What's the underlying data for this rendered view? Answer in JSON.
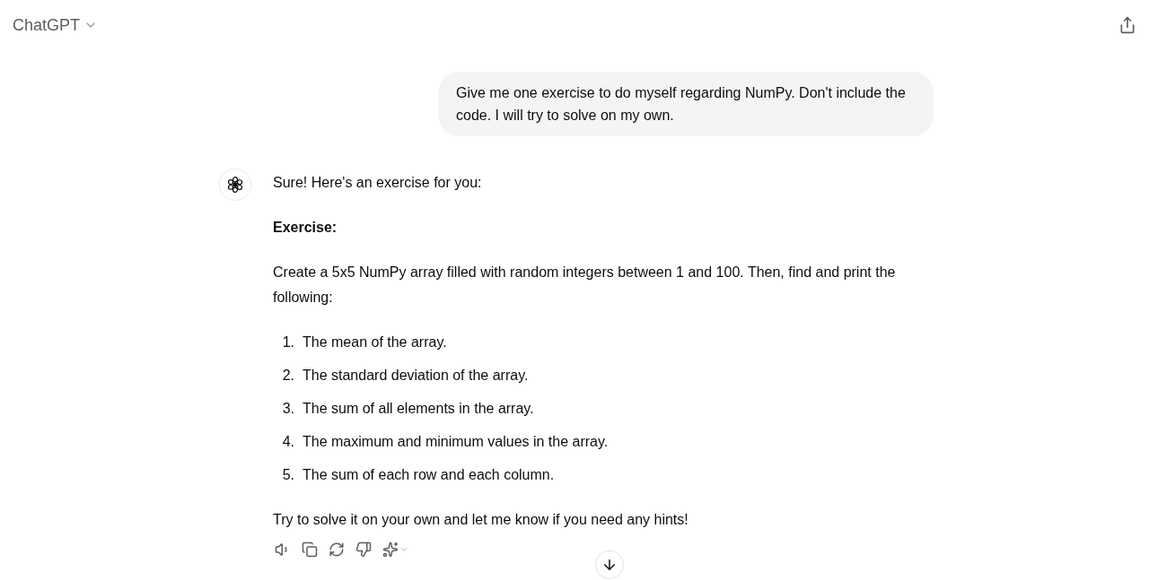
{
  "header": {
    "title": "ChatGPT"
  },
  "user_message": {
    "text": "Give me one exercise to do myself regarding NumPy. Don't include the code. I will try to solve on my own."
  },
  "assistant_message": {
    "intro": "Sure! Here's an exercise for you:",
    "heading": "Exercise:",
    "task": "Create a 5x5 NumPy array filled with random integers between 1 and 100. Then, find and print the following:",
    "steps": [
      {
        "number": "1.",
        "text": "The mean of the array."
      },
      {
        "number": "2.",
        "text": "The standard deviation of the array."
      },
      {
        "number": "3.",
        "text": "The sum of all elements in the array."
      },
      {
        "number": "4.",
        "text": "The maximum and minimum values in the array."
      },
      {
        "number": "5.",
        "text": "The sum of each row and each column."
      }
    ],
    "closing": "Try to solve it on your own and let me know if you need any hints!"
  }
}
